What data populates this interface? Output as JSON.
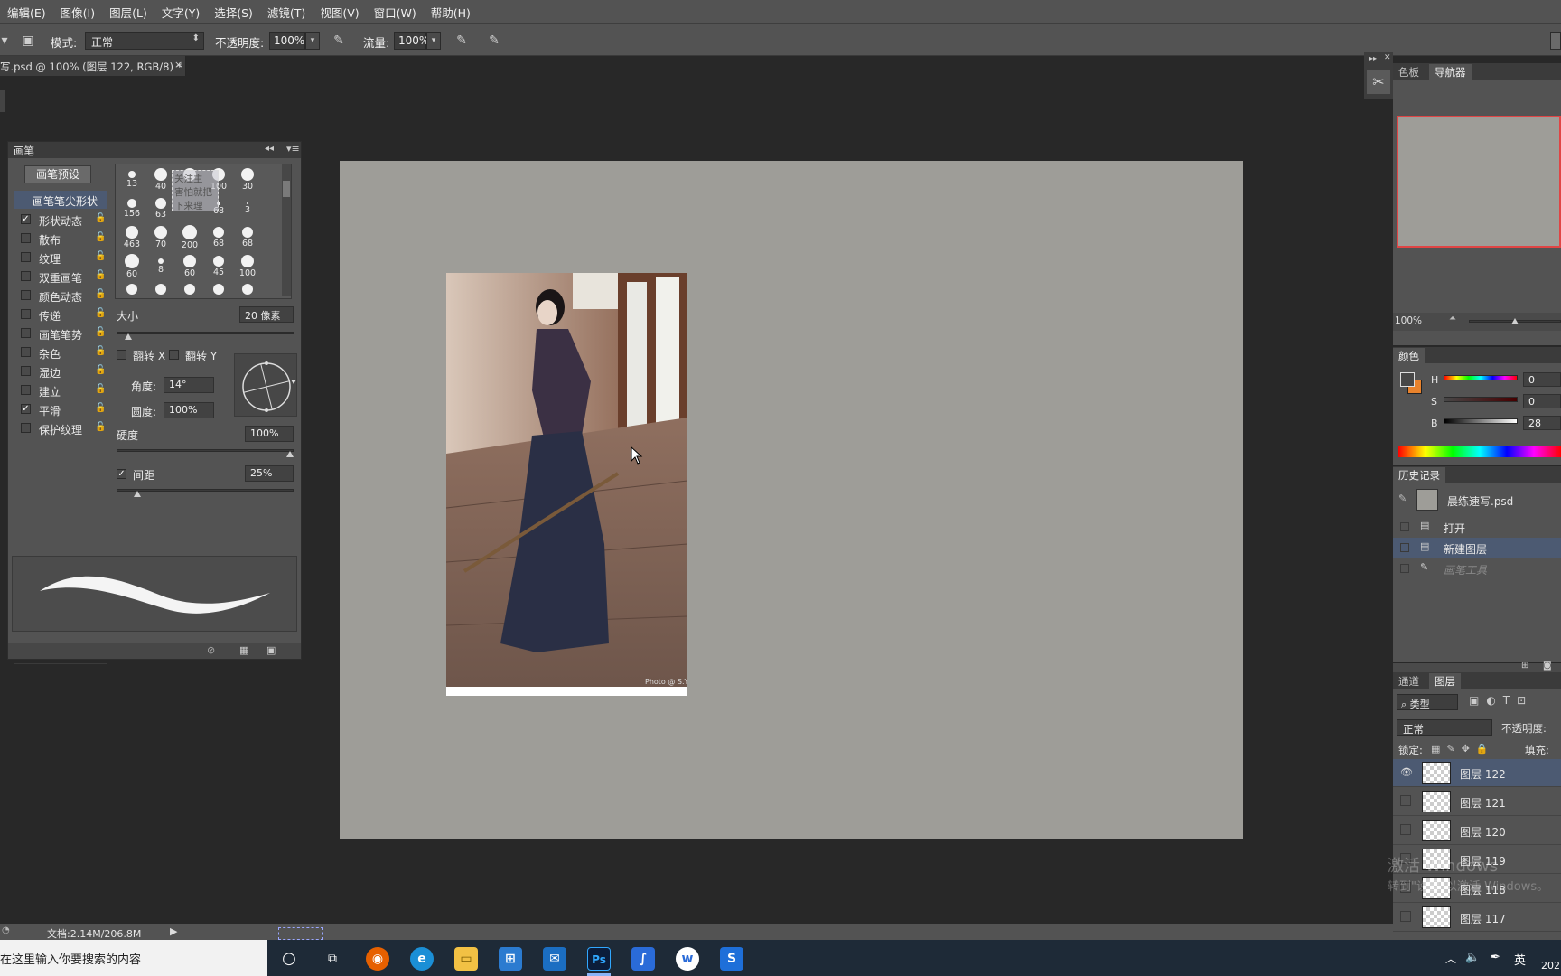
{
  "menu": [
    "编辑(E)",
    "图像(I)",
    "图层(L)",
    "文字(Y)",
    "选择(S)",
    "滤镜(T)",
    "视图(V)",
    "窗口(W)",
    "帮助(H)"
  ],
  "options": {
    "mode_label": "模式:",
    "mode_value": "正常",
    "opacity_label": "不透明度:",
    "opacity_value": "100%",
    "flow_label": "流量:",
    "flow_value": "100%"
  },
  "doc_tab": {
    "title": "写.psd @ 100% (图层 122, RGB/8) *",
    "close": "×"
  },
  "photo": {
    "watermark": "Photo @ S.Y"
  },
  "brush_panel": {
    "title": "画笔",
    "preset_button": "画笔预设",
    "tip_shape": "画笔笔尖形状",
    "options": [
      {
        "label": "形状动态",
        "checked": true
      },
      {
        "label": "散布",
        "checked": false
      },
      {
        "label": "纹理",
        "checked": false
      },
      {
        "label": "双重画笔",
        "checked": false
      },
      {
        "label": "颜色动态",
        "checked": false
      },
      {
        "label": "传递",
        "checked": false
      },
      {
        "label": "画笔笔势",
        "checked": false
      },
      {
        "label": "杂色",
        "checked": false
      },
      {
        "label": "湿边",
        "checked": false
      },
      {
        "label": "建立",
        "checked": false
      },
      {
        "label": "平滑",
        "checked": true
      },
      {
        "label": "保护纹理",
        "checked": false
      }
    ],
    "tips": [
      [
        "13",
        "40",
        "",
        "100",
        "30"
      ],
      [
        "156",
        "63",
        "",
        "68",
        "3"
      ],
      [
        "463",
        "70",
        "200",
        "68",
        "68"
      ],
      [
        "60",
        "8",
        "60",
        "45",
        "100"
      ]
    ],
    "watermark_text": [
      "关注主",
      "害怕就把",
      "下来理"
    ],
    "size_label": "大小",
    "size_value": "20 像素",
    "flip_x": "翻转 X",
    "flip_y": "翻转 Y",
    "angle_label": "角度:",
    "angle_value": "14°",
    "roundness_label": "圆度:",
    "roundness_value": "100%",
    "hardness_label": "硬度",
    "hardness_value": "100%",
    "spacing_label": "间距",
    "spacing_value": "25%",
    "spacing_checked": true,
    "size_slider_level": 0.05,
    "hardness_slider_level": 1.0,
    "spacing_slider_level": 0.1
  },
  "navigator": {
    "tabs": [
      "色板",
      "导航器"
    ],
    "active_tab": "导航器",
    "zoom": "100%",
    "zoom_slider_level": 0.5
  },
  "color_panel": {
    "title": "颜色",
    "h_label": "H",
    "h_value": "0",
    "s_label": "S",
    "s_value": "0",
    "b_label": "B",
    "b_value": "28",
    "fg_color": "#474747",
    "bg_color": "#e8822c"
  },
  "history": {
    "title": "历史记录",
    "snapshot": "晨练速写.psd",
    "items": [
      "打开",
      "新建图层",
      "画笔工具"
    ],
    "active_index": 1
  },
  "layers": {
    "tabs": [
      "通道",
      "图层"
    ],
    "active_tab": "图层",
    "filter_label": "类型",
    "blend_mode": "正常",
    "opacity_label": "不透明度:",
    "lock_label": "锁定:",
    "fill_label": "填充:",
    "items": [
      "图层 122",
      "图层 121",
      "图层 120",
      "图层 119",
      "图层 118",
      "图层 117"
    ],
    "active_index": 0
  },
  "activation": {
    "line1": "激活 Windows",
    "line2": "转到\"设置\"以激活 Windows。"
  },
  "status": {
    "doc": "文档:2.14M/206.8M"
  },
  "taskbar": {
    "search_placeholder": "在这里输入你要搜索的内容",
    "ime": "英",
    "clock_partial": "202"
  }
}
